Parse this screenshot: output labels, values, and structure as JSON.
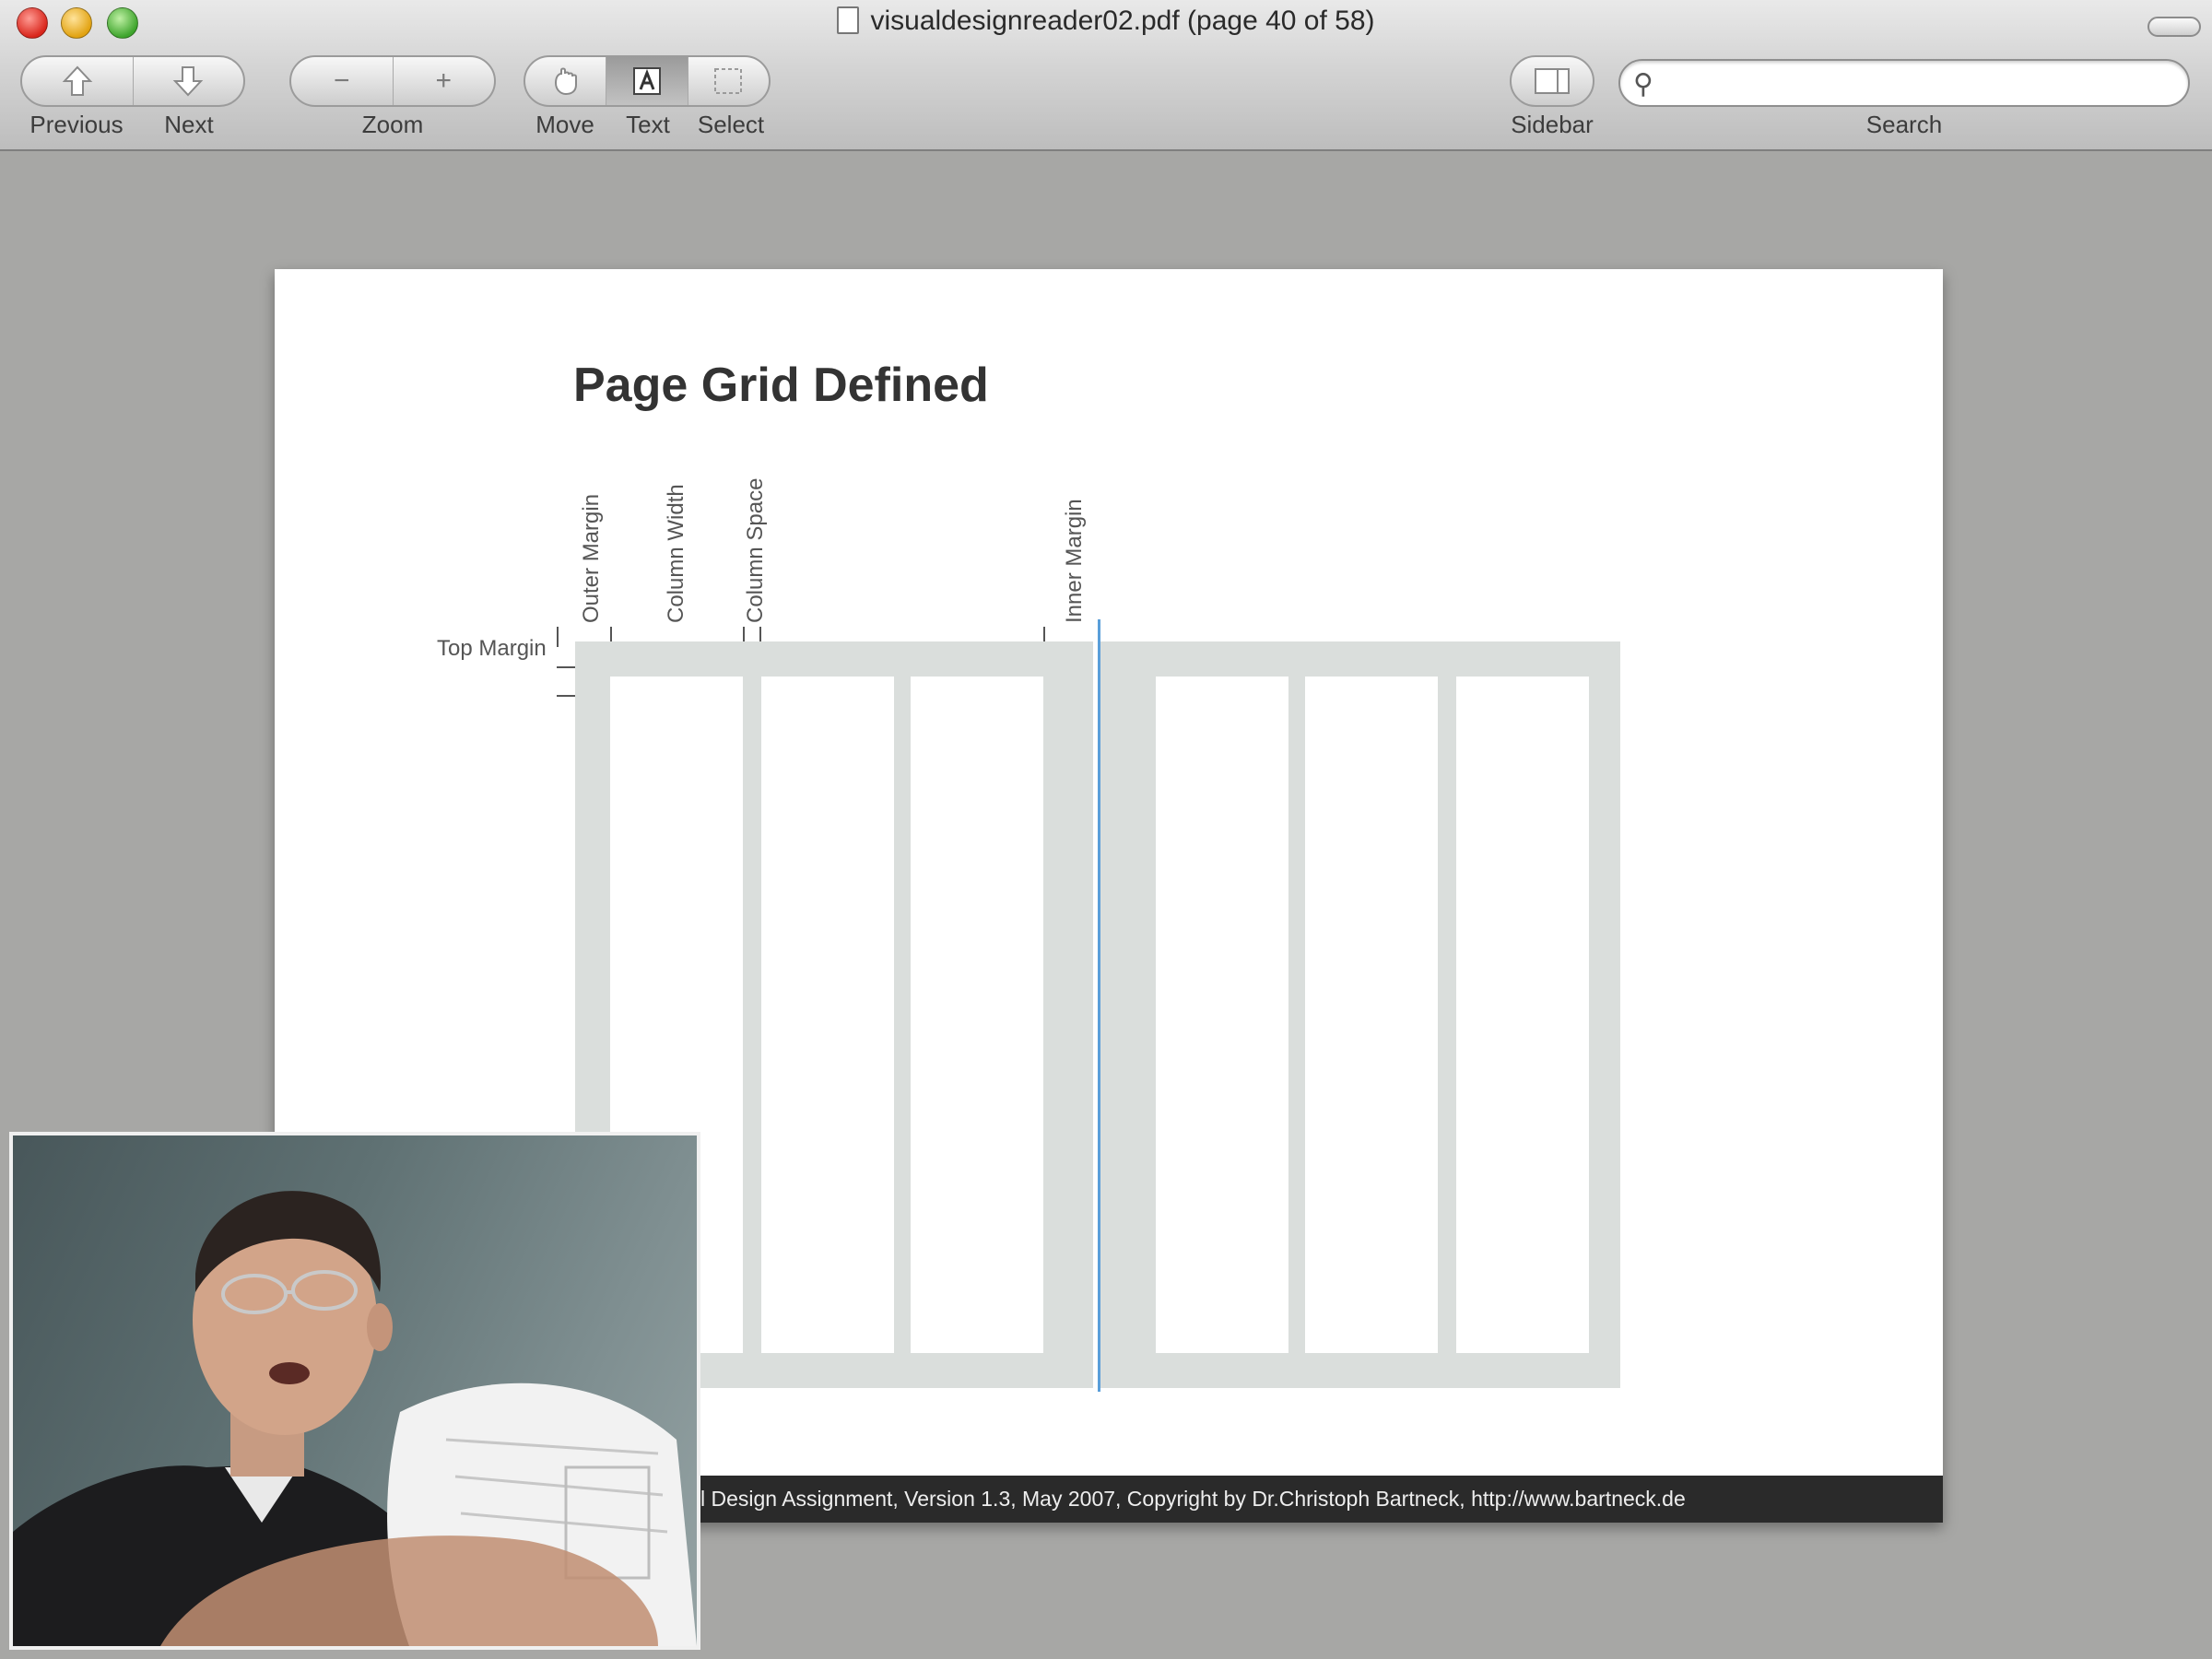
{
  "window": {
    "title": "visualdesignreader02.pdf (page 40 of 58)"
  },
  "toolbar": {
    "previous_label": "Previous",
    "next_label": "Next",
    "zoom_label": "Zoom",
    "move_label": "Move",
    "text_label": "Text",
    "select_label": "Select",
    "sidebar_label": "Sidebar",
    "search_label": "Search",
    "search_value": "",
    "active_tool": "Text"
  },
  "document": {
    "title": "Page Grid Defined",
    "labels": {
      "outer_margin": "Outer Margin",
      "column_width": "Column Width",
      "column_space": "Column Space",
      "inner_margin": "Inner Margin",
      "top_margin": "Top Margin"
    },
    "footer": "l Design Assignment, Version 1.3, May 2007, Copyright by Dr.Christoph Bartneck, http://www.bartneck.de"
  },
  "colors": {
    "grid_gray": "#dadedc",
    "guide_blue": "#5a9ed9",
    "footer_bg": "#2a2a2a"
  }
}
